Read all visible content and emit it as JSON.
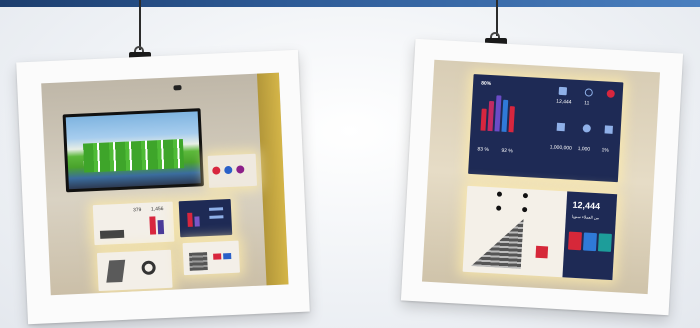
{
  "photos": {
    "left": {
      "stats": {
        "a": "379",
        "b": "1,456"
      },
      "marquee": "▤▤▤",
      "dot_colors": [
        "#d8263e",
        "#2a60c8",
        "#8c1f88",
        "#d8263e"
      ]
    },
    "right": {
      "header_pct": "80%",
      "pct_left": "83 %",
      "pct_right": "92 %",
      "kpis": [
        "12,444",
        "11",
        "1,000,000",
        "1,000",
        "1%"
      ],
      "big_number": "12,444",
      "arabic_caption": "من العملاء سنويا",
      "tile_colors": [
        "#d62839",
        "#2f7ad8",
        "#1d9d9a",
        "#e04a8a"
      ]
    }
  },
  "colors": {
    "accent_blue": "#2d5a96",
    "navy_panel": "#1e2a55",
    "tv_green": "#49a22c",
    "warm_glow": "#ffecaa"
  }
}
